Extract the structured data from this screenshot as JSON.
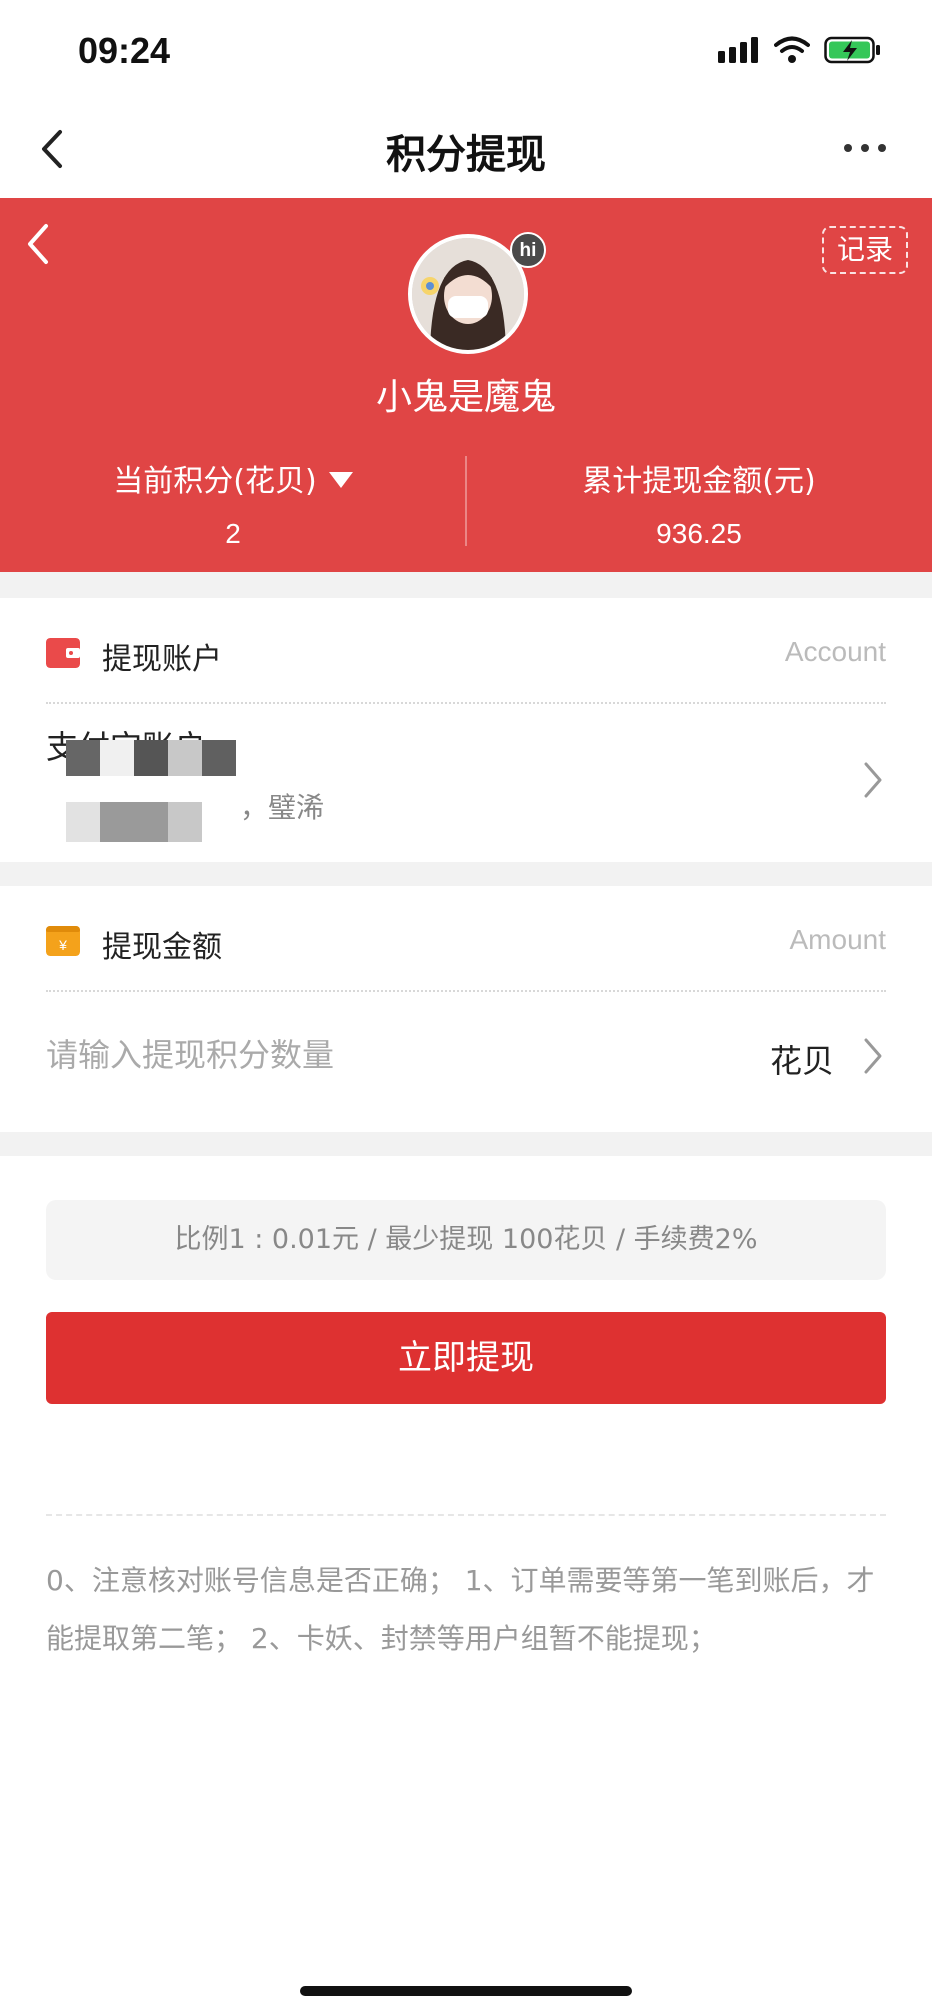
{
  "status_bar": {
    "time": "09:24"
  },
  "nav": {
    "title": "积分提现"
  },
  "header": {
    "record_label": "记录",
    "avatar_badge": "hi",
    "username": "小鬼是魔鬼",
    "points_label": "当前积分(花贝)",
    "points_value": "2",
    "total_label": "累计提现金额(元)",
    "total_value": "936.25",
    "accent_color": "#e04545"
  },
  "account_section": {
    "label": "提现账户",
    "label_en": "Account",
    "account_name": "支付宝账户",
    "account_owner": "，璧浠"
  },
  "amount_section": {
    "label": "提现金额",
    "label_en": "Amount",
    "placeholder": "请输入提现积分数量",
    "unit": "花贝"
  },
  "ratio_text": "比例1 : 0.01元 / 最少提现 100花贝 / 手续费2%",
  "withdraw_button": "立即提现",
  "notes": "0、注意核对账号信息是否正确； 1、订单需要等第一笔到账后，才能提取第二笔； 2、卡妖、封禁等用户组暂不能提现；",
  "icons": {
    "back": "chevron-left-icon",
    "more": "more-horizontal-icon",
    "wallet": "wallet-icon",
    "yuan": "yuan-icon",
    "chevron": "chevron-right-icon"
  }
}
